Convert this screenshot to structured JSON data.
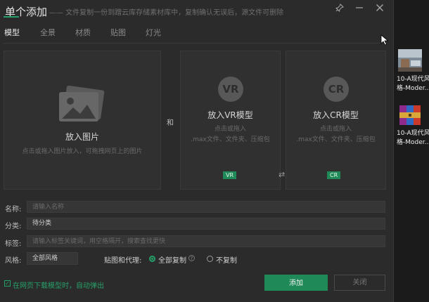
{
  "dialog": {
    "title": "单个添加",
    "subtitle": "—— 文件复制一份到蹭云库存储素材库中，复制确认无误后，源文件可删除"
  },
  "tabs": [
    {
      "label": "模型",
      "active": true
    },
    {
      "label": "全景",
      "active": false
    },
    {
      "label": "材质",
      "active": false
    },
    {
      "label": "贴图",
      "active": false
    },
    {
      "label": "灯光",
      "active": false
    }
  ],
  "cards": {
    "image": {
      "title": "放入图片",
      "hint": "点击或拖入图片放入，可拖拽网页上的图片"
    },
    "and_label": "和",
    "vr": {
      "badge": "VR",
      "title": "放入VR模型",
      "hint_line1": "点击或拖入",
      "hint_line2": ".max文件、文件夹、压缩包",
      "tag": "VR"
    },
    "cr": {
      "badge": "CR",
      "title": "放入CR模型",
      "hint_line1": "点击或拖入",
      "hint_line2": ".max文件、文件夹、压缩包",
      "tag": "CR"
    }
  },
  "form": {
    "name": {
      "label": "名称:",
      "placeholder": "请输入名称",
      "value": ""
    },
    "category": {
      "label": "分类:",
      "value": "待分类"
    },
    "tags": {
      "label": "标签:",
      "placeholder": "请输入标签关键词，用空格隔开，搜索查找更快",
      "value": ""
    },
    "style": {
      "label": "风格:",
      "value": "全部风格"
    },
    "texture_proxy": {
      "label": "贴图和代理:",
      "options": [
        {
          "label": "全部复制",
          "selected": true
        },
        {
          "label": "不复制",
          "selected": false
        }
      ]
    }
  },
  "footer": {
    "auto_popup_label": "在网页下载模型时，自动弹出",
    "auto_popup_checked": true,
    "add_button": "添加",
    "close_button": "关闭"
  },
  "desktop_icons": [
    {
      "label_line1": "10-A现代风",
      "label_line2": "格-Moder..."
    },
    {
      "label_line1": "10-A现代风",
      "label_line2": "格-Moder..."
    }
  ],
  "colors": {
    "accent": "#26a06a",
    "dialog_bg": "#2b2b2b",
    "card_bg": "#303030"
  }
}
